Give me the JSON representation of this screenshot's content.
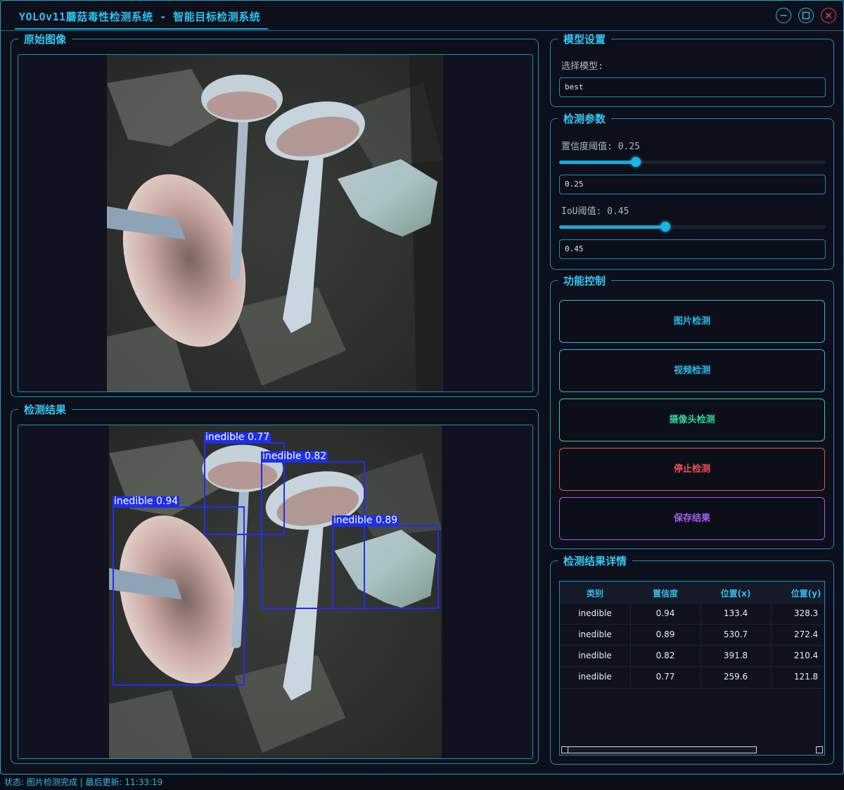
{
  "window": {
    "title": "YOLOv11蘑菇毒性检测系统 - 智能目标检测系统"
  },
  "panels": {
    "original": "原始图像",
    "result": "检测结果",
    "model": "模型设置",
    "params": "检测参数",
    "controls": "功能控制",
    "details": "检测结果详情"
  },
  "model": {
    "select_label": "选择模型:",
    "selected": "best"
  },
  "params": {
    "conf_label": "置信度阈值: 0.25",
    "conf_value": "0.25",
    "conf_level": 0.25,
    "iou_label": "IoU阈值: 0.45",
    "iou_value": "0.45",
    "iou_level": 0.45
  },
  "buttons": {
    "image": "图片检测",
    "video": "视频检测",
    "camera": "摄像头检测",
    "stop": "停止检测",
    "save": "保存结果"
  },
  "colors": {
    "accent": "#1aa6d6",
    "image_btn": "#2db7ea",
    "video_btn": "#2db7ea",
    "camera_btn": "#2fd39b",
    "stop_btn": "#f0505a",
    "save_btn": "#a55df0",
    "box": "#1d2ff0"
  },
  "detections": [
    {
      "label": "inedible 0.77"
    },
    {
      "label": "inedible 0.82"
    },
    {
      "label": "inedible 0.94"
    },
    {
      "label": "inedible 0.89"
    }
  ],
  "table": {
    "headers": [
      "类别",
      "置信度",
      "位置(x)",
      "位置(y)"
    ],
    "rows": [
      [
        "inedible",
        "0.94",
        "133.4",
        "328.3"
      ],
      [
        "inedible",
        "0.89",
        "530.7",
        "272.4"
      ],
      [
        "inedible",
        "0.82",
        "391.8",
        "210.4"
      ],
      [
        "inedible",
        "0.77",
        "259.6",
        "121.8"
      ]
    ]
  },
  "status": "状态: 图片检测完成 | 最后更新: 11:33:19"
}
